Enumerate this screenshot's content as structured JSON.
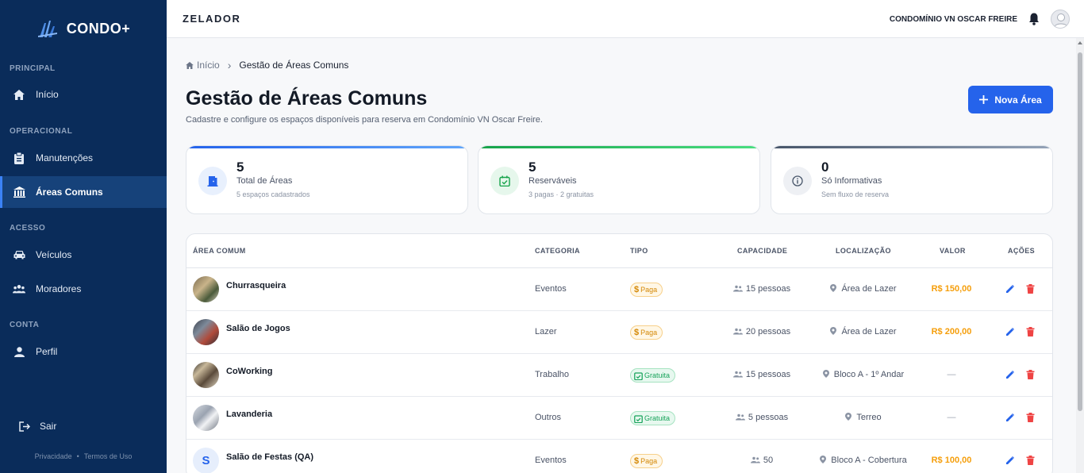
{
  "sidebar": {
    "brand": "CONDO+",
    "sections": {
      "principal": "PRINCIPAL",
      "operacional": "OPERACIONAL",
      "acesso": "ACESSO",
      "conta": "CONTA"
    },
    "items": [
      {
        "label": "Início",
        "icon": "home-icon"
      },
      {
        "label": "Manutenções",
        "icon": "clipboard-icon"
      },
      {
        "label": "Áreas Comuns",
        "icon": "building-icon",
        "active": true
      },
      {
        "label": "Veículos",
        "icon": "car-icon"
      },
      {
        "label": "Moradores",
        "icon": "people-icon"
      },
      {
        "label": "Perfil",
        "icon": "person-icon"
      }
    ],
    "logout": "Sair",
    "footer": {
      "privacy": "Privacidade",
      "sep": "•",
      "terms": "Termos de Uso"
    }
  },
  "topbar": {
    "title": "ZELADOR",
    "condo": "CONDOMÍNIO VN OSCAR FREIRE"
  },
  "breadcrumb": {
    "home": "Início",
    "sep": "›",
    "current": "Gestão de Áreas Comuns"
  },
  "page": {
    "title": "Gestão de Áreas Comuns",
    "subtitle": "Cadastre e configure os espaços disponíveis para reserva em Condomínio VN Oscar Freire.",
    "new_button": "Nova Área"
  },
  "stats": [
    {
      "value": "5",
      "label": "Total de Áreas",
      "sub": "5 espaços cadastrados",
      "color": "#3b82f6"
    },
    {
      "value": "5",
      "label": "Reserváveis",
      "sub": "3 pagas · 2 gratuitas",
      "color": "#22c55e"
    },
    {
      "value": "0",
      "label": "Só Informativas",
      "sub": "Sem fluxo de reserva",
      "color": "#64748b"
    }
  ],
  "table": {
    "headers": {
      "area": "ÁREA COMUM",
      "categoria": "CATEGORIA",
      "tipo": "TIPO",
      "capacidade": "CAPACIDADE",
      "localizacao": "LOCALIZAÇÃO",
      "valor": "VALOR",
      "acoes": "AÇÕES"
    },
    "rows": [
      {
        "name": "Churrasqueira",
        "categoria": "Eventos",
        "tipo": "Paga",
        "capacidade": "15 pessoas",
        "localizacao": "Área de Lazer",
        "valor": "R$ 150,00"
      },
      {
        "name": "Salão de Jogos",
        "categoria": "Lazer",
        "tipo": "Paga",
        "capacidade": "20 pessoas",
        "localizacao": "Área de Lazer",
        "valor": "R$ 200,00"
      },
      {
        "name": "CoWorking",
        "categoria": "Trabalho",
        "tipo": "Gratuita",
        "capacidade": "15 pessoas",
        "localizacao": "Bloco A - 1º Andar",
        "valor": "—"
      },
      {
        "name": "Lavanderia",
        "categoria": "Outros",
        "tipo": "Gratuita",
        "capacidade": "5 pessoas",
        "localizacao": "Terreo",
        "valor": "—"
      },
      {
        "name": "Salão de Festas (QA)",
        "initial": "S",
        "categoria": "Eventos",
        "tipo": "Paga",
        "capacidade": "50",
        "localizacao": "Bloco A - Cobertura",
        "valor": "R$ 100,00"
      }
    ]
  }
}
